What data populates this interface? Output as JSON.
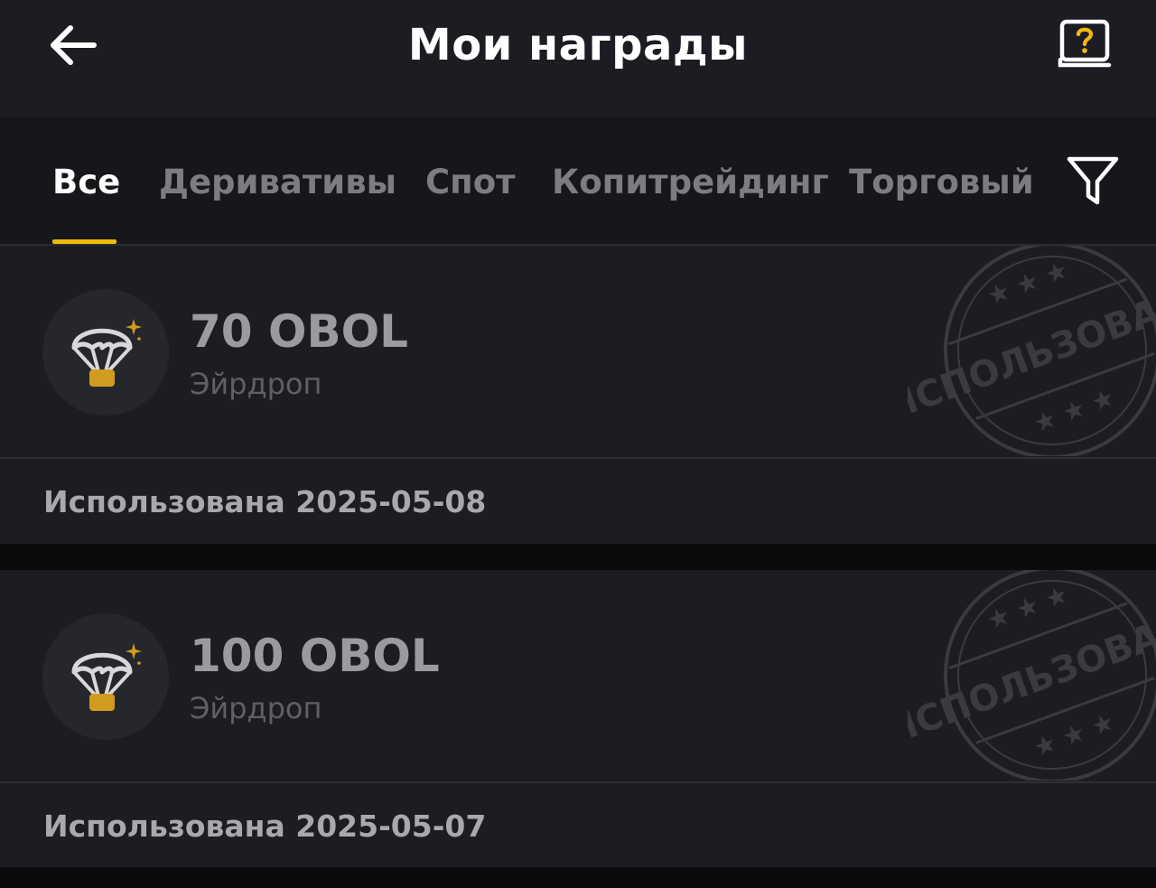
{
  "header": {
    "title": "Мои награды",
    "back_icon": "arrow-left-icon",
    "help_icon": "help-book-icon"
  },
  "tabs": [
    {
      "label": "Все",
      "active": true
    },
    {
      "label": "Деривативы",
      "active": false
    },
    {
      "label": "Спот",
      "active": false
    },
    {
      "label": "Копитрейдинг",
      "active": false
    },
    {
      "label": "Торговый",
      "active": false
    }
  ],
  "filter_icon": "filter-funnel-icon",
  "rewards": [
    {
      "amount": "70 OBOL",
      "type": "Эйрдроп",
      "status": "Использована 2025-05-08",
      "stamp_text": "ИСПОЛЬЗОВАНО",
      "icon": "airdrop-parachute-icon"
    },
    {
      "amount": "100 OBOL",
      "type": "Эйрдроп",
      "status": "Использована 2025-05-07",
      "stamp_text": "ИСПОЛЬЗОВАНО",
      "icon": "airdrop-parachute-icon"
    }
  ],
  "colors": {
    "accent": "#f0b90b",
    "background": "#1c1d22",
    "page_background": "#0b0b0d"
  }
}
